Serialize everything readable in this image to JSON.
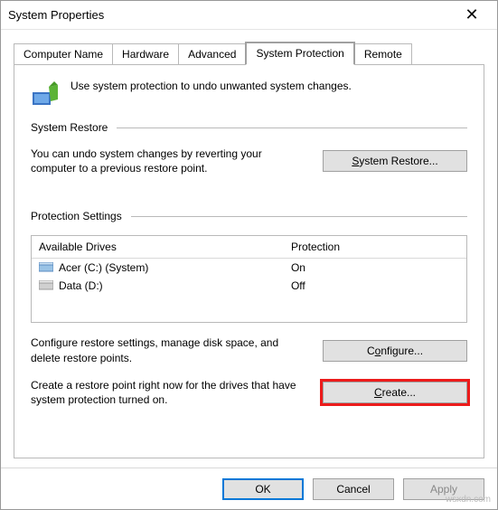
{
  "window": {
    "title": "System Properties",
    "close_label": "✕"
  },
  "tabs": [
    {
      "label": "Computer Name",
      "active": false
    },
    {
      "label": "Hardware",
      "active": false
    },
    {
      "label": "Advanced",
      "active": false
    },
    {
      "label": "System Protection",
      "active": true
    },
    {
      "label": "Remote",
      "active": false
    }
  ],
  "intro_text": "Use system protection to undo unwanted system changes.",
  "system_restore": {
    "heading": "System Restore",
    "text": "You can undo system changes by reverting your computer to a previous restore point.",
    "button": "System Restore..."
  },
  "protection_settings": {
    "heading": "Protection Settings",
    "columns": {
      "drives": "Available Drives",
      "protection": "Protection"
    },
    "rows": [
      {
        "name": "Acer (C:) (System)",
        "protection": "On"
      },
      {
        "name": "Data (D:)",
        "protection": "Off"
      }
    ],
    "configure_text": "Configure restore settings, manage disk space, and delete restore points.",
    "configure_button": "Configure...",
    "create_text": "Create a restore point right now for the drives that have system protection turned on.",
    "create_button": "Create..."
  },
  "footer": {
    "ok": "OK",
    "cancel": "Cancel",
    "apply": "Apply"
  },
  "watermark": "wsxdn.com"
}
